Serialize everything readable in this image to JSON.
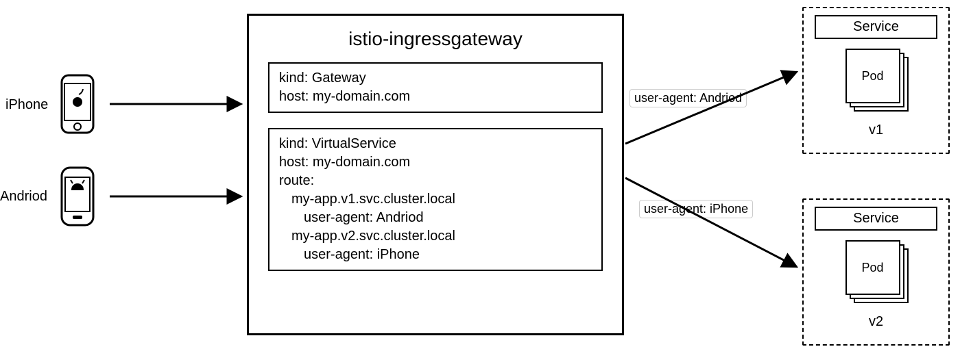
{
  "clients": {
    "iphone_label": "iPhone",
    "android_label": "Andriod"
  },
  "gateway": {
    "title": "istio-ingressgateway",
    "spec_lines": [
      "kind: Gateway",
      "host: my-domain.com"
    ]
  },
  "virtual_service": {
    "lines": {
      "kind": "kind: VirtualService",
      "host": "host: my-domain.com",
      "route": "route:",
      "r1": "my-app.v1.svc.cluster.local",
      "r1_ua": "user-agent: Andriod",
      "r2": "my-app.v2.svc.cluster.local",
      "r2_ua": "user-agent: iPhone"
    }
  },
  "edges": {
    "to_v1": "user-agent: Andriod",
    "to_v2": "user-agent: iPhone"
  },
  "services": {
    "header": "Service",
    "pod_label": "Pod",
    "v1": "v1",
    "v2": "v2"
  }
}
